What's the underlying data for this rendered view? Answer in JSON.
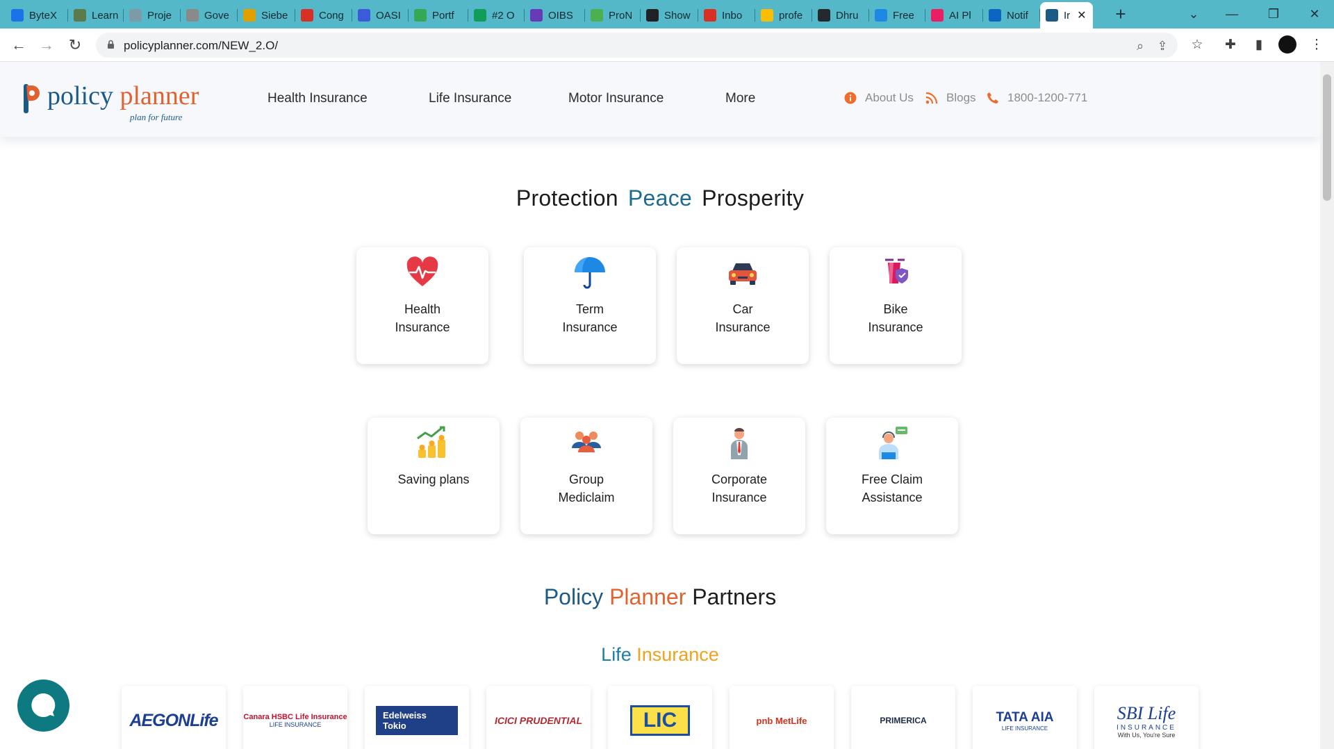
{
  "browser": {
    "tabs": [
      {
        "title": "ByteX",
        "color": "#1a73e8"
      },
      {
        "title": "Learn",
        "color": "#5b7b4a"
      },
      {
        "title": "Proje",
        "color": "#7d9aa7"
      },
      {
        "title": "Gove",
        "color": "#8a8a8a"
      },
      {
        "title": "Siebe",
        "color": "#e0a100"
      },
      {
        "title": "Cong",
        "color": "#d93025"
      },
      {
        "title": "OASI",
        "color": "#3b5bdb"
      },
      {
        "title": "Portf",
        "color": "#34a853"
      },
      {
        "title": "#2 O",
        "color": "#0f9d58"
      },
      {
        "title": "OIBS",
        "color": "#673ab7"
      },
      {
        "title": "ProN",
        "color": "#4caf50"
      },
      {
        "title": "Show",
        "color": "#202124"
      },
      {
        "title": "Inbo",
        "color": "#d93025"
      },
      {
        "title": "profe",
        "color": "#fbbc04"
      },
      {
        "title": "Dhru",
        "color": "#24292e"
      },
      {
        "title": "Free",
        "color": "#1e88e5"
      },
      {
        "title": "AI Pl",
        "color": "#e91e63"
      },
      {
        "title": "Notif",
        "color": "#0a66c2"
      },
      {
        "title": "Ir",
        "color": "#1c5a86"
      }
    ],
    "new_tab": "+",
    "url": "policyplanner.com/NEW_2.O/"
  },
  "site": {
    "logo_word1": "policy",
    "logo_word2": "planner",
    "logo_tagline": "plan for future",
    "nav": [
      "Health Insurance",
      "Life Insurance",
      "Motor Insurance",
      "More"
    ],
    "util": {
      "about": "About Us",
      "blogs": "Blogs",
      "phone": "1800-1200-771"
    },
    "tagline": {
      "w1": "Protection",
      "w2": "Peace",
      "w3": "Prosperity"
    },
    "products_row1": [
      {
        "line1": "Health",
        "line2": "Insurance",
        "icon": "heart-pulse-icon"
      },
      {
        "line1": "Term",
        "line2": "Insurance",
        "icon": "umbrella-icon"
      },
      {
        "line1": "Car",
        "line2": "Insurance",
        "icon": "car-icon"
      },
      {
        "line1": "Bike",
        "line2": "Insurance",
        "icon": "scooter-shield-icon"
      }
    ],
    "products_row2": [
      {
        "line1": "Saving plans",
        "line2": "",
        "icon": "coins-growth-icon"
      },
      {
        "line1": "Group",
        "line2": "Mediclaim",
        "icon": "group-people-icon"
      },
      {
        "line1": "Corporate",
        "line2": "Insurance",
        "icon": "businessman-icon"
      },
      {
        "line1": "Free Claim",
        "line2": "Assistance",
        "icon": "support-agent-icon"
      }
    ],
    "partners_title": {
      "w1": "Policy",
      "w2": "Planner",
      "w3": "Partners"
    },
    "life_title": {
      "w1": "Life",
      "w2": "Insurance"
    },
    "partners": [
      {
        "name": "AEGONLife",
        "color": "#1c3f94"
      },
      {
        "name": "Canara HSBC Life Insurance",
        "color": "#c8102e"
      },
      {
        "name": "Edelweiss Tokio",
        "color": "#1f3f86"
      },
      {
        "name": "ICICI PRUDENTIAL",
        "color": "#b02a30"
      },
      {
        "name": "LIC",
        "color": "#1d4fa1"
      },
      {
        "name": "pnb MetLife",
        "color": "#d6311c"
      },
      {
        "name": "PRIMERICA",
        "color": "#1b2b4b"
      },
      {
        "name": "TATA AIA",
        "color": "#1c3f94"
      },
      {
        "name": "SBI Life",
        "color": "#1c3f94"
      }
    ],
    "partner_subtexts": {
      "canara": "LIFE INSURANCE",
      "sbi_sub": "INSURANCE",
      "sbi_tag": "With Us, You're Sure",
      "tata_sub": "LIFE INSURANCE"
    }
  }
}
